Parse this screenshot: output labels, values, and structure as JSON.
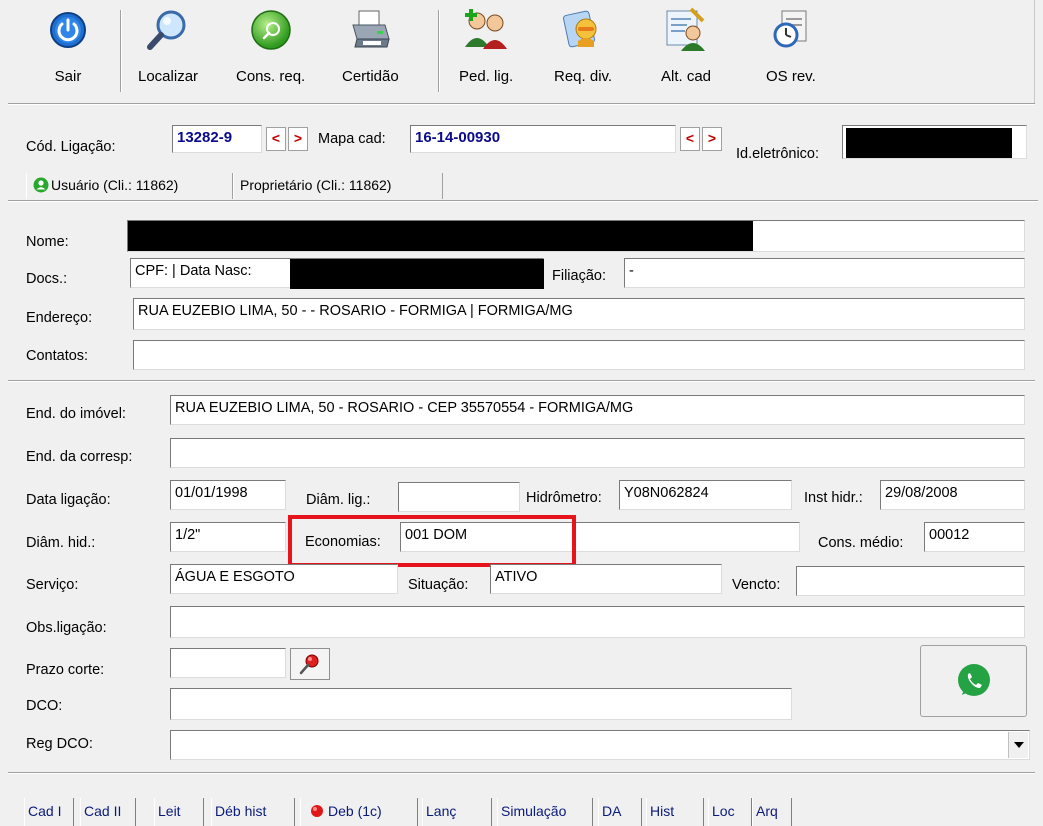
{
  "toolbar": {
    "buttons": [
      {
        "label": "Sair",
        "icon": "power-icon"
      },
      {
        "label": "Localizar",
        "icon": "magnifier-icon"
      },
      {
        "label": "Cons. req.",
        "icon": "green-orb-icon"
      },
      {
        "label": "Certidão",
        "icon": "printer-icon"
      },
      {
        "label": "Ped. lig.",
        "icon": "users-add-icon"
      },
      {
        "label": "Req. div.",
        "icon": "request-icon"
      },
      {
        "label": "Alt. cad",
        "icon": "edit-user-icon"
      },
      {
        "label": "OS rev.",
        "icon": "clock-doc-icon"
      }
    ]
  },
  "header": {
    "cod_ligacao_label": "Cód. Ligação:",
    "cod_ligacao_value": "13282-9",
    "mapa_cad_label": "Mapa cad:",
    "mapa_cad_value": "16-14-00930",
    "id_eletronico_label": "Id.eletrônico:",
    "prev": "<",
    "next": ">"
  },
  "person_tabs": [
    {
      "label": "Usuário (Cli.: 11862)",
      "active": true
    },
    {
      "label": "Proprietário (Cli.: 11862)",
      "active": false
    }
  ],
  "user": {
    "nome_label": "Nome:",
    "docs_label": "Docs.:",
    "docs_value": "CPF:  | Data Nasc:",
    "filiacao_label": "Filiação:",
    "filiacao_value": "-",
    "endereco_label": "Endereço:",
    "endereco_value": "RUA EUZEBIO LIMA, 50 -  - ROSARIO - FORMIGA | FORMIGA/MG",
    "contatos_label": "Contatos:",
    "contatos_value": ""
  },
  "property": {
    "end_imovel_label": "End. do imóvel:",
    "end_imovel_value": "RUA EUZEBIO LIMA, 50 - ROSARIO - CEP 35570554 - FORMIGA/MG",
    "end_corresp_label": "End. da corresp:",
    "end_corresp_value": "",
    "data_ligacao_label": "Data ligação:",
    "data_ligacao_value": "01/01/1998",
    "diam_lig_label": "Diâm. lig.:",
    "diam_lig_value": "",
    "hidrometro_label": "Hidrômetro:",
    "hidrometro_value": "Y08N062824",
    "inst_hidr_label": "Inst hidr.:",
    "inst_hidr_value": "29/08/2008",
    "diam_hid_label": "Diâm. hid.:",
    "diam_hid_value": "1/2\"",
    "economias_label": "Economias:",
    "economias_value": "001 DOM",
    "cons_medio_label": "Cons. médio:",
    "cons_medio_value": "00012",
    "servico_label": "Serviço:",
    "servico_value": "ÁGUA E ESGOTO",
    "situacao_label": "Situação:",
    "situacao_value": "ATIVO",
    "vencto_label": "Vencto:",
    "vencto_value": "",
    "obs_label": "Obs.ligação:",
    "obs_value": "",
    "prazo_label": "Prazo corte:",
    "prazo_value": "",
    "dco_label": "DCO:",
    "dco_value": "",
    "reg_dco_label": "Reg DCO:",
    "reg_dco_value": ""
  },
  "bottom_tabs": [
    {
      "label": "Cad I"
    },
    {
      "label": "Cad II"
    },
    {
      "label": "Leit"
    },
    {
      "label": "Déb hist"
    },
    {
      "label": "Deb (1c)"
    },
    {
      "label": "Lanç"
    },
    {
      "label": "Simulação"
    },
    {
      "label": "DA"
    },
    {
      "label": "Hist"
    },
    {
      "label": "Loc"
    },
    {
      "label": "Arq"
    }
  ],
  "colors": {
    "accent_blue": "#0a0a8c",
    "highlight_red": "#e8141b",
    "whatsapp_green": "#25a244"
  }
}
